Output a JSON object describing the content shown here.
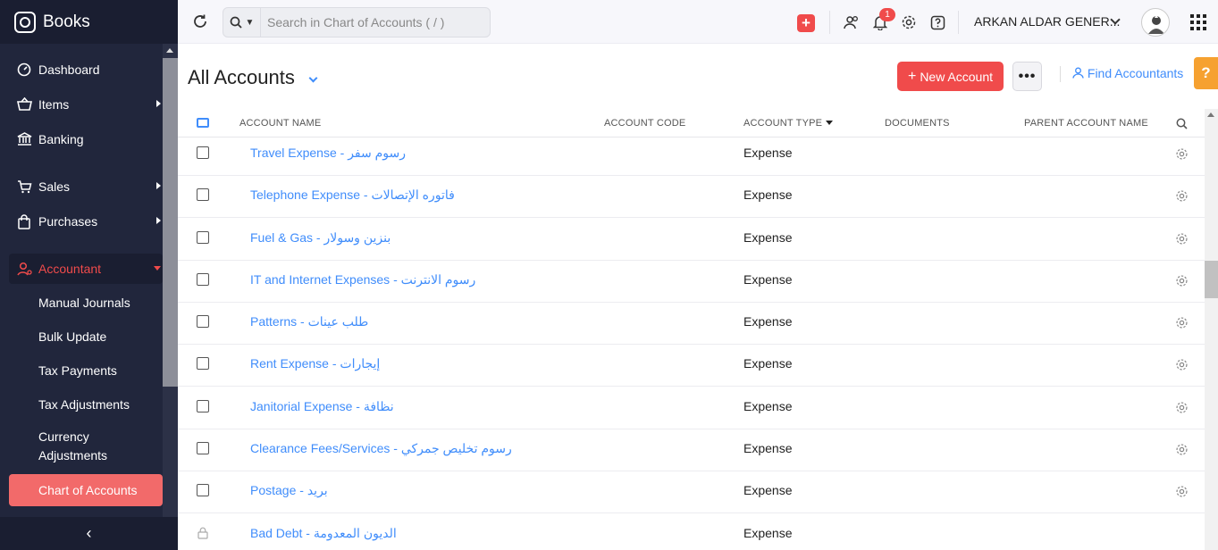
{
  "app": {
    "brand": "Books"
  },
  "sidebar": {
    "items": [
      {
        "label": "Dashboard",
        "icon": "dashboard-icon"
      },
      {
        "label": "Items",
        "icon": "basket-icon"
      },
      {
        "label": "Banking",
        "icon": "bank-icon"
      },
      {
        "label": "Sales",
        "icon": "cart-icon"
      },
      {
        "label": "Purchases",
        "icon": "bag-icon"
      },
      {
        "label": "Accountant",
        "icon": "accountant-icon"
      }
    ],
    "sub_items": [
      "Manual Journals",
      "Bulk Update",
      "Tax Payments",
      "Tax Adjustments",
      "Currency Adjustments",
      "Chart of Accounts"
    ],
    "active_sub": "Chart of Accounts",
    "collapse_glyph": "‹"
  },
  "topbar": {
    "search_placeholder": "Search in Chart of Accounts ( / )",
    "notification_count": "1",
    "org_name": "ARKAN ALDAR GENER..."
  },
  "header": {
    "title": "All Accounts",
    "new_button": "New Account",
    "more_button": "•••",
    "find_accountants": "Find Accountants",
    "help": "?"
  },
  "table": {
    "columns": [
      "ACCOUNT NAME",
      "ACCOUNT CODE",
      "ACCOUNT TYPE",
      "DOCUMENTS",
      "PARENT ACCOUNT NAME"
    ],
    "rows": [
      {
        "name": "Travel Expense - رسوم سفر",
        "type": "Expense",
        "locked": false
      },
      {
        "name": "Telephone Expense - فاتوره الإتصالات",
        "type": "Expense",
        "locked": false
      },
      {
        "name": "Fuel & Gas - بنزين وسولار",
        "type": "Expense",
        "locked": false
      },
      {
        "name": "IT and Internet Expenses - رسوم الانترنت",
        "type": "Expense",
        "locked": false
      },
      {
        "name": "Patterns - طلب عينات",
        "type": "Expense",
        "locked": false
      },
      {
        "name": "Rent Expense - إيجارات",
        "type": "Expense",
        "locked": false
      },
      {
        "name": "Janitorial Expense - نظافة",
        "type": "Expense",
        "locked": false
      },
      {
        "name": "Clearance Fees/Services - رسوم تخليص جمركي",
        "type": "Expense",
        "locked": false
      },
      {
        "name": "Postage - بريد",
        "type": "Expense",
        "locked": false
      },
      {
        "name": "Bad Debt - الديون المعدومة",
        "type": "Expense",
        "locked": true
      }
    ]
  },
  "colors": {
    "accent": "#408dfb",
    "brand_red": "#f04b4b",
    "sidebar_bg": "#21263c"
  }
}
